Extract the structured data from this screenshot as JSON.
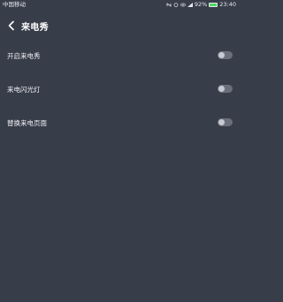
{
  "status_bar": {
    "carrier": "中国移动",
    "battery": "92%",
    "time": "23:40",
    "battery_level": 0.92
  },
  "header": {
    "title": "来电秀"
  },
  "settings": [
    {
      "label": "开启来电秀",
      "enabled": false
    },
    {
      "label": "来电闪光灯",
      "enabled": false
    },
    {
      "label": "替换来电页面",
      "enabled": false
    }
  ],
  "colors": {
    "background": "#383d4a",
    "toggle_off": "#6a6f7b",
    "battery_fill": "#4cd964"
  }
}
